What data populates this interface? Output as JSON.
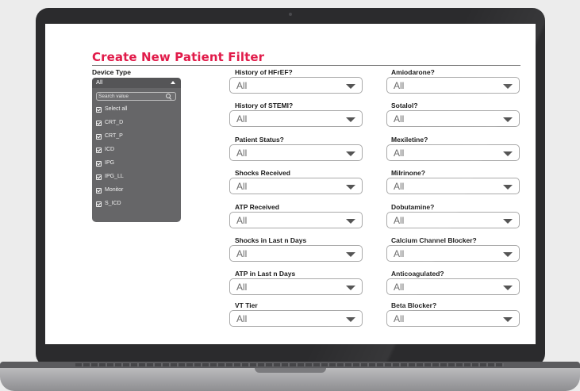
{
  "page_title": "Create New Patient Filter",
  "device_type": {
    "label": "Device Type",
    "selected": "All",
    "search_placeholder": "Search value",
    "options": [
      "Select all",
      "CRT_D",
      "CRT_P",
      "ICD",
      "IPG",
      "IPG_LL",
      "Monitor",
      "S_ICD"
    ]
  },
  "filters_col1": [
    {
      "label": "History of HFrEF?",
      "value": "All"
    },
    {
      "label": "History of STEMI?",
      "value": "All"
    },
    {
      "label": "Patient Status?",
      "value": "All"
    },
    {
      "label": "Shocks Received",
      "value": "All"
    },
    {
      "label": "ATP Received",
      "value": "All"
    },
    {
      "label": "Shocks in Last n Days",
      "value": "All"
    },
    {
      "label": "ATP in Last n Days",
      "value": "All"
    },
    {
      "label": "VT Tier",
      "value": "All"
    }
  ],
  "filters_col2": [
    {
      "label": "Amiodarone?",
      "value": "All"
    },
    {
      "label": "Sotalol?",
      "value": "All"
    },
    {
      "label": "Mexiletine?",
      "value": "All"
    },
    {
      "label": "Milrinone?",
      "value": "All"
    },
    {
      "label": "Dobutamine?",
      "value": "All"
    },
    {
      "label": "Calcium Channel Blocker?",
      "value": "All"
    },
    {
      "label": "Anticoagulated?",
      "value": "All"
    },
    {
      "label": "Beta Blocker?",
      "value": "All"
    }
  ],
  "colors": {
    "title": "#e11b4a",
    "dropdown_panel": "#666668",
    "laptop_bezel": "#2b2b2d"
  }
}
